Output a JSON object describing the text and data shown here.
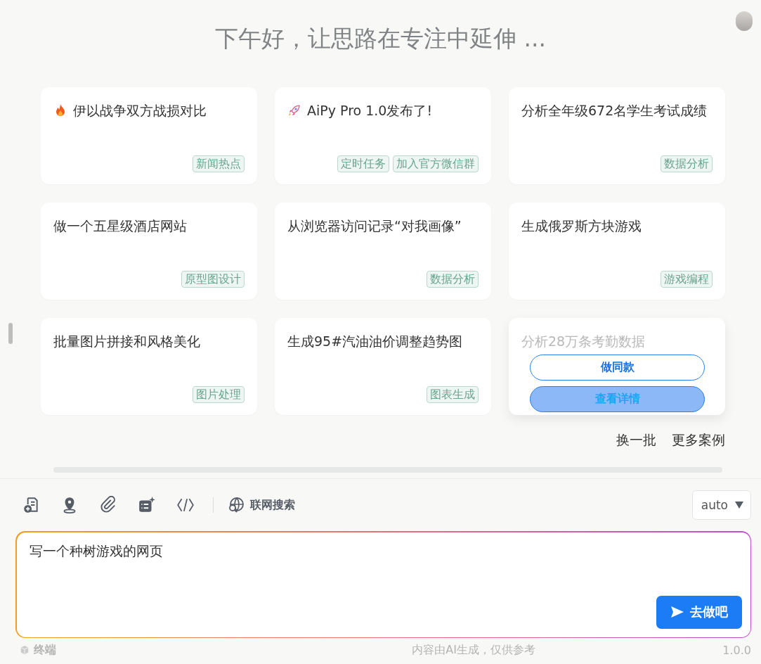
{
  "greeting": "下午好，让思路在专注中延伸 ...",
  "cards": [
    {
      "kind": "fire",
      "title": "伊以战争双方战损对比",
      "tags": [
        "新闻热点"
      ],
      "hovered": false
    },
    {
      "kind": "rocket",
      "title": "AiPy Pro 1.0发布了!",
      "tags": [
        "定时任务",
        "加入官方微信群"
      ],
      "hovered": false
    },
    {
      "kind": "plain",
      "title": "分析全年级672名学生考试成绩",
      "tags": [
        "数据分析"
      ],
      "hovered": false
    },
    {
      "kind": "plain",
      "title": "做一个五星级酒店网站",
      "tags": [
        "原型图设计"
      ],
      "hovered": false
    },
    {
      "kind": "plain",
      "title": "从浏览器访问记录“对我画像”",
      "tags": [
        "数据分析"
      ],
      "hovered": false
    },
    {
      "kind": "plain",
      "title": "生成俄罗斯方块游戏",
      "tags": [
        "游戏编程"
      ],
      "hovered": false
    },
    {
      "kind": "plain",
      "title": "批量图片拼接和风格美化",
      "tags": [
        "图片处理"
      ],
      "hovered": false
    },
    {
      "kind": "plain",
      "title": "生成95#汽油油价调整趋势图",
      "tags": [
        "图表生成"
      ],
      "hovered": false
    },
    {
      "kind": "plain",
      "title": "分析28万条考勤数据",
      "hovered": true
    }
  ],
  "card_actions": [
    "做同款",
    "查看详情"
  ],
  "links": [
    "换一批",
    "更多案例"
  ],
  "toolbar": {
    "web_search": "联网搜索",
    "model": "auto"
  },
  "prompt": {
    "value": "写一个种树游戏的网页",
    "send": "去做吧"
  },
  "footer": {
    "terminal": "终端",
    "disclaimer": "内容由AI生成，仅供参考",
    "version": "1.0.0"
  }
}
